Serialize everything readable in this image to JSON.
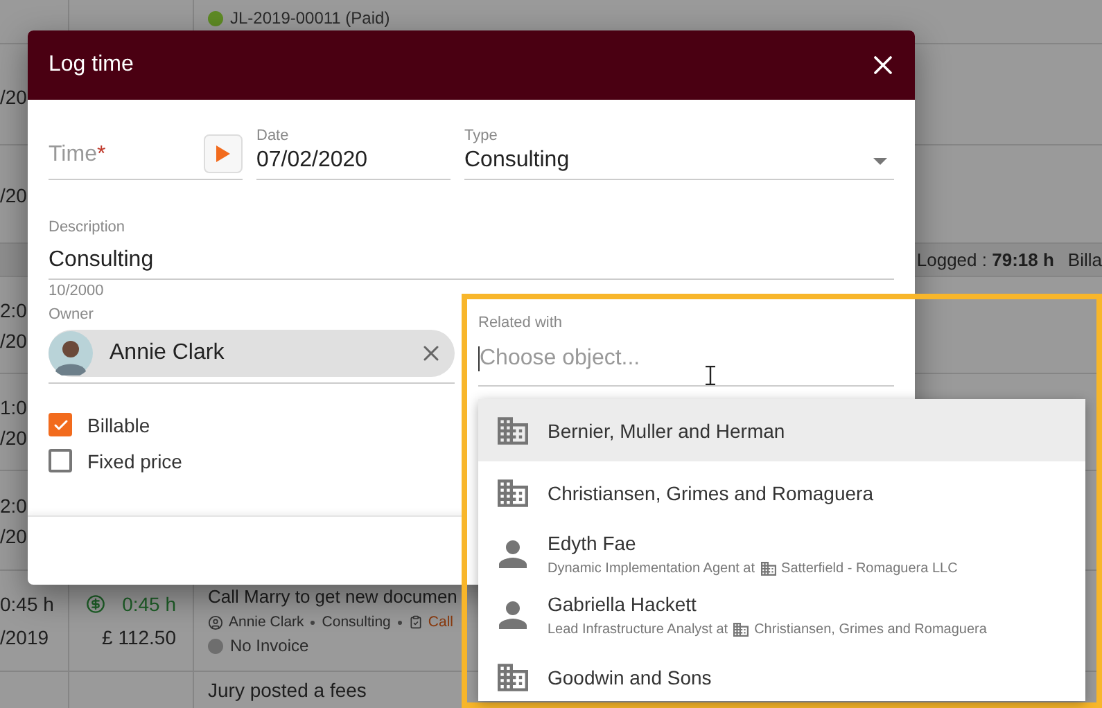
{
  "table": {
    "top_row": {
      "invoice": {
        "label": "JL-2019-00011 (Paid)",
        "color": "#5e8a24"
      }
    },
    "rows_before_summary": [
      {
        "date": "/20"
      },
      {
        "date": "/20"
      }
    ],
    "summary": {
      "logged_label": "Logged :",
      "logged_value": "79:18 h",
      "billable_label": "Billa"
    },
    "rows_after_summary": [
      {
        "time": "2:0",
        "date": "/20"
      },
      {
        "time": "1:0",
        "date": "/20"
      },
      {
        "time": "2:0",
        "date": "/20"
      }
    ],
    "entry": {
      "duration": "0:45 h",
      "date": "/2019",
      "billed_time": "0:45 h",
      "amount": "£ 112.50",
      "title": "Call Marry to get new documen",
      "owner": "Annie Clark",
      "type": "Consulting",
      "task": "Call",
      "invoice": {
        "label": "No Invoice",
        "color": "#6e6e6e"
      }
    },
    "next_entry": {
      "title": "Jury posted a fees"
    }
  },
  "dialog": {
    "title": "Log time",
    "time": {
      "placeholder": "Time",
      "required_mark": "*"
    },
    "date": {
      "label": "Date",
      "value": "07/02/2020"
    },
    "type": {
      "label": "Type",
      "value": "Consulting"
    },
    "description": {
      "label": "Description",
      "value": "Consulting",
      "counter": "10/2000"
    },
    "owner": {
      "label": "Owner",
      "value": "Annie Clark"
    },
    "checkboxes": [
      {
        "label": "Billable",
        "checked": true
      },
      {
        "label": "Fixed price",
        "checked": false
      }
    ],
    "related": {
      "label": "Related with",
      "placeholder": "Choose object...",
      "options": [
        {
          "kind": "company",
          "name": "Bernier, Muller and Herman",
          "selected": true
        },
        {
          "kind": "company",
          "name": "Christiansen, Grimes and Romaguera",
          "selected": false
        },
        {
          "kind": "person",
          "name": "Edyth Fae",
          "role": "Dynamic Implementation Agent at",
          "company": "Satterfield - Romaguera LLC",
          "selected": false
        },
        {
          "kind": "person",
          "name": "Gabriella Hackett",
          "role": "Lead Infrastructure Analyst at",
          "company": "Christiansen, Grimes and Romaguera",
          "selected": false
        },
        {
          "kind": "company",
          "name": "Goodwin and Sons",
          "selected": false
        }
      ]
    }
  }
}
